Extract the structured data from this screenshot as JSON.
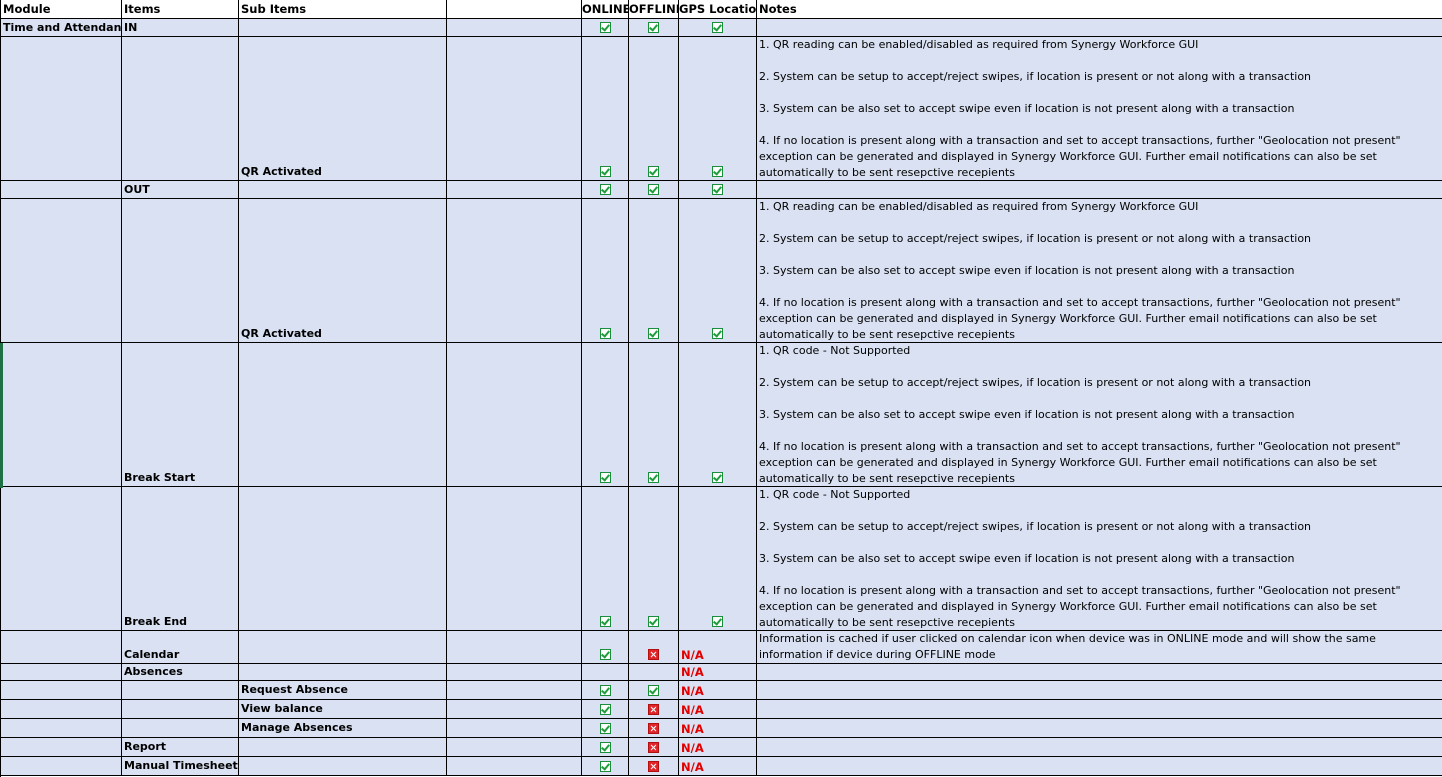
{
  "headers": {
    "module": "Module",
    "items": "Items",
    "sub_items": "Sub Items",
    "blank": "",
    "online": "ONLINE",
    "offline": "OFFLINE",
    "gps": "GPS Location",
    "notes": "Notes"
  },
  "rows": {
    "r1": {
      "module": "Time and Attendance",
      "item": "IN"
    },
    "r2": {
      "sub": "QR Activated",
      "notes": [
        "1. QR reading can be enabled/disabled as required from Synergy Workforce GUI",
        "2. System can be setup to accept/reject swipes, if location is present or not along with a transaction",
        "3. System can be also set to accept swipe even if location is not present along with a transaction",
        "4. If no location is present along with a transaction and set to accept transactions, further \"Geolocation not present\" exception can be generated and displayed in Synergy Workforce GUI. Further email notifications can also be set automatically to be sent resepctive recepients"
      ]
    },
    "r3": {
      "item": "OUT"
    },
    "r4": {
      "sub": "QR Activated",
      "notes": [
        "1. QR reading can be enabled/disabled as required from Synergy Workforce GUI",
        "2. System can be setup to accept/reject swipes, if location is present or not along with a transaction",
        "3. System can be also set to accept swipe even if location is not present along with a transaction",
        "4. If no location is present along with a transaction and set to accept transactions, further \"Geolocation not present\" exception can be generated and displayed in Synergy Workforce GUI. Further email notifications can also be set automatically to be sent resepctive recepients"
      ]
    },
    "r5": {
      "item": "Break Start",
      "notes": [
        "1.  QR code - Not Supported",
        "2. System can be setup to accept/reject swipes, if location is present or not along with a transaction",
        "3. System can be also set to accept swipe even if location is not present along with a transaction",
        "4. If no location is present along with a transaction and set to accept transactions, further \"Geolocation not present\" exception can be generated and displayed in Synergy Workforce GUI. Further email notifications can also be set automatically to be sent resepctive recepients"
      ]
    },
    "r6": {
      "item": "Break End",
      "notes": [
        "1.  QR code - Not Supported",
        "2. System can be setup to accept/reject swipes, if location is present or not along with a transaction",
        "3. System can be also set to accept swipe even if location is not present along with a transaction",
        "4. If no location is present along with a transaction and set to accept transactions, further \"Geolocation not present\" exception can be generated and displayed in Synergy Workforce GUI. Further email notifications can also be set automatically to be sent resepctive recepients"
      ]
    },
    "r7": {
      "item": "Calendar",
      "gps": "N/A",
      "notes": "Information is cached if user clicked on calendar icon when device was in ONLINE mode and will show the same information if device during OFFLINE mode"
    },
    "r8": {
      "item": "Absences",
      "gps": "N/A"
    },
    "r9": {
      "sub": "Request Absence",
      "gps": "N/A"
    },
    "r10": {
      "sub": "View balance",
      "gps": "N/A"
    },
    "r11": {
      "sub": "Manage Absences",
      "gps": "N/A"
    },
    "r12": {
      "item": "Report",
      "gps": "N/A"
    },
    "r13": {
      "item": "Manual Timesheet",
      "gps": "N/A"
    }
  },
  "icons": {
    "check": "check-icon",
    "cross": "cross-icon"
  },
  "colors": {
    "row_fill": "#d9e1f2",
    "check_green": "#1f9d3c",
    "cross_red": "#e0262b",
    "na_red": "#e00000"
  }
}
